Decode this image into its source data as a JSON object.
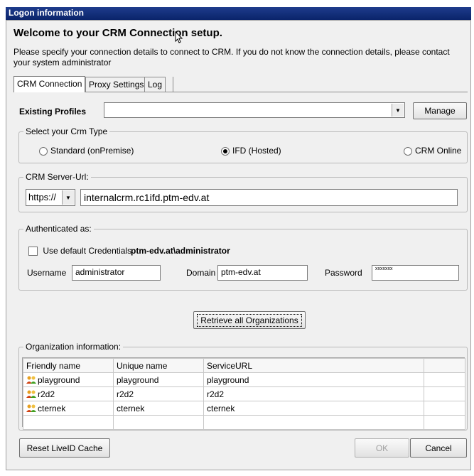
{
  "window": {
    "title": "Logon information"
  },
  "header": {
    "welcome": "Welcome to your CRM Connection setup.",
    "description": "Please specify your connection details to connect to CRM. If you do not know the connection details, please contact your system administrator"
  },
  "tabs": [
    {
      "label": "CRM Connection",
      "active": true
    },
    {
      "label": "Proxy Settings",
      "active": false
    },
    {
      "label": "Log",
      "active": false
    }
  ],
  "profiles": {
    "label": "Existing Profiles",
    "value": "",
    "manage_label": "Manage"
  },
  "crm_type": {
    "legend": "Select your Crm Type",
    "options": [
      {
        "label": "Standard (onPremise)",
        "selected": false
      },
      {
        "label": "IFD (Hosted)",
        "selected": true
      },
      {
        "label": "CRM Online",
        "selected": false
      }
    ]
  },
  "server": {
    "legend": "CRM Server-Url:",
    "protocol": "https://",
    "url": "internalcrm.rc1ifd.ptm-edv.at"
  },
  "auth": {
    "legend": "Authenticated as:",
    "default_creds_label": "Use default Credentials",
    "default_creds_checked": false,
    "current_user": "ptm-edv.at\\administrator",
    "username_label": "Username",
    "username": "administrator",
    "domain_label": "Domain",
    "domain": "ptm-edv.at",
    "password_label": "Password",
    "password": "xxxxxxx"
  },
  "retrieve_label": "Retrieve all Organizations",
  "orgs": {
    "legend": "Organization information:",
    "columns": [
      "Friendly name",
      "Unique name",
      "ServiceURL"
    ],
    "rows": [
      [
        "playground",
        "playground",
        "playground"
      ],
      [
        "r2d2",
        "r2d2",
        "r2d2"
      ],
      [
        "cternek",
        "cternek",
        "cternek"
      ]
    ]
  },
  "footer": {
    "reset_label": "Reset LiveID Cache",
    "ok_label": "OK",
    "cancel_label": "Cancel"
  }
}
